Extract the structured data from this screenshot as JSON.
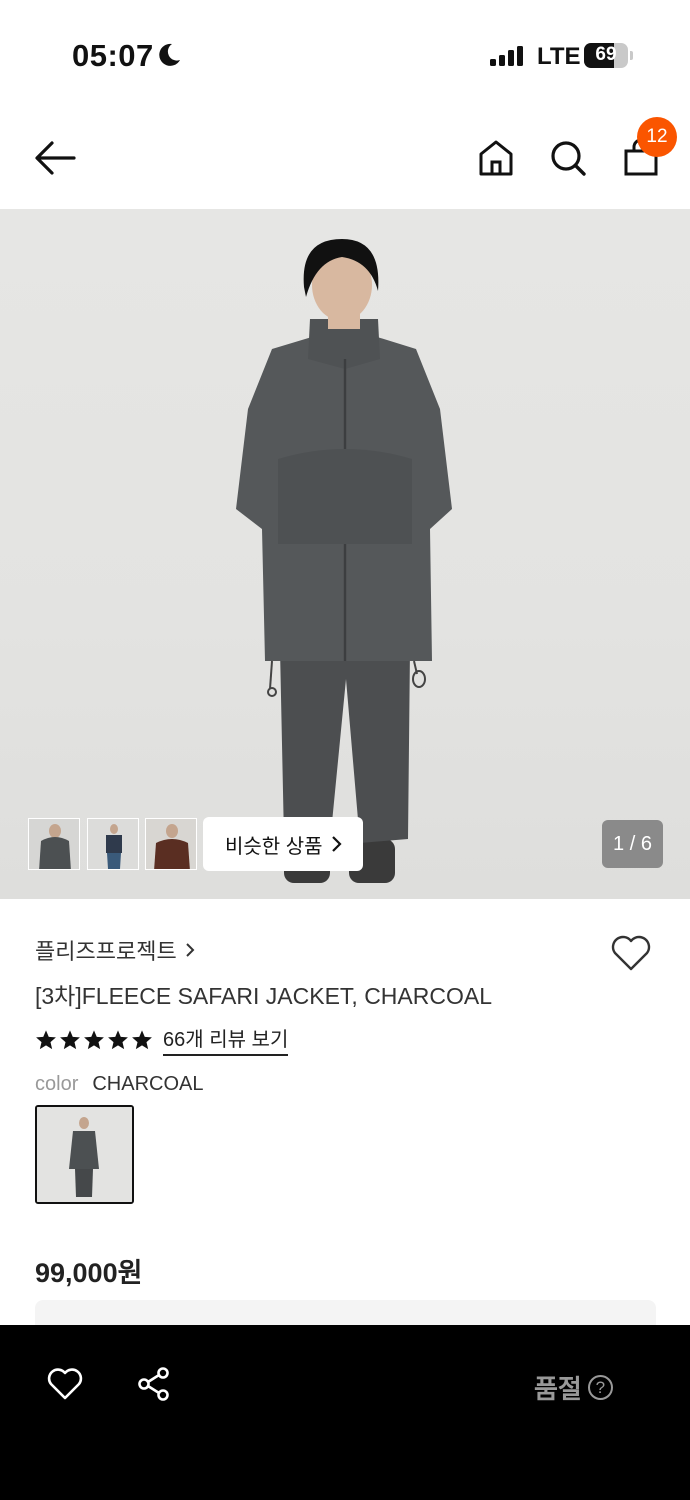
{
  "status_bar": {
    "time": "05:07",
    "network": "LTE",
    "battery_percent": 69,
    "battery_label": "69"
  },
  "nav": {
    "back_icon": "arrow-left-icon",
    "home_icon": "home-icon",
    "search_icon": "search-icon",
    "cart_icon": "shopping-bag-icon",
    "cart_count": "12",
    "badge_color": "#fa5500"
  },
  "gallery": {
    "similar_label": "비슷한 상품",
    "page_indicator": "1 / 6",
    "thumbnail_count": 3
  },
  "product": {
    "brand": "플리즈프로젝트",
    "name": "[3차]FLEECE SAFARI JACKET, CHARCOAL",
    "rating_stars": 5,
    "review_link": "66개 리뷰 보기",
    "color_label": "color",
    "color_value": "CHARCOAL",
    "price": "99,000원"
  },
  "bottom_bar": {
    "like_icon": "heart-icon",
    "share_icon": "share-icon",
    "soldout_label": "품절",
    "help_icon": "question-circle-icon"
  }
}
